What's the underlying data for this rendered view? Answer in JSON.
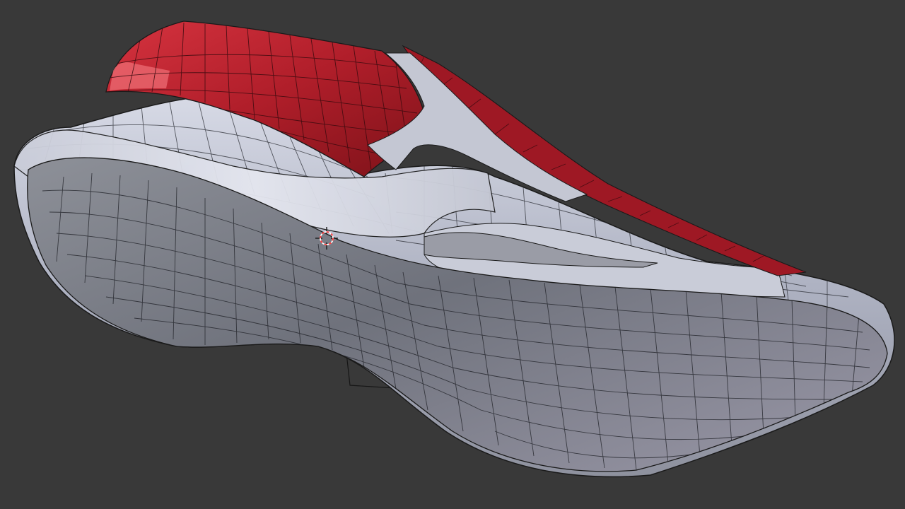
{
  "viewport": {
    "background_color": "#393939",
    "mesh": {
      "subject": "shoe-mesh",
      "upper_color": "#b8202c",
      "upper_highlight_color": "#f07078",
      "body_color": "#b4b8c8",
      "sole_color": "#7c7f8a",
      "edge_color": "#1a1a1a"
    },
    "cursor_icon": "3d-cursor-icon",
    "cursor_colors": [
      "#ff4040",
      "#ffffff"
    ]
  }
}
